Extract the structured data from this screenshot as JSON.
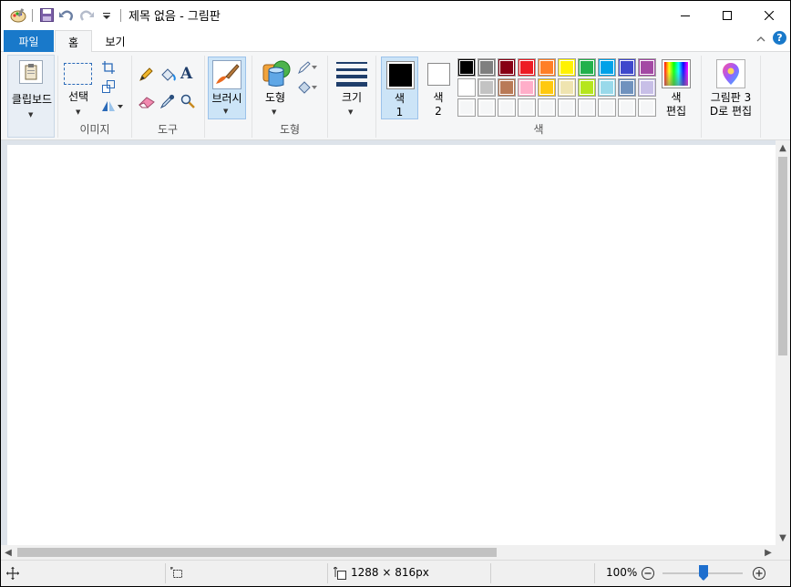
{
  "window": {
    "title": "제목 없음 - 그림판",
    "minimize_glyph": "—",
    "maximize_glyph": "☐",
    "close_glyph": "✕"
  },
  "quick_access": {
    "icons": [
      "paint-app-icon",
      "save-icon",
      "undo-icon",
      "redo-icon",
      "customize-dropdown-icon"
    ]
  },
  "tabs": {
    "file": "파일",
    "home": "홈",
    "view": "보기"
  },
  "ribbon": {
    "clipboard": {
      "label": "클립보드"
    },
    "image": {
      "select_label": "선택",
      "group_label": "이미지"
    },
    "tools": {
      "group_label": "도구"
    },
    "brushes": {
      "label": "브러시"
    },
    "shapes": {
      "label": "도형",
      "group_label": "도형"
    },
    "size": {
      "label": "크기"
    },
    "colors": {
      "color1_label_a": "색",
      "color1_label_b": "1",
      "color2_label_a": "색",
      "color2_label_b": "2",
      "edit_label_a": "색",
      "edit_label_b": "편집",
      "group_label": "색",
      "color1": "#000000",
      "color2": "#ffffff",
      "palette_row1": [
        "#000000",
        "#7f7f7f",
        "#880015",
        "#ed1c24",
        "#ff7f27",
        "#fff200",
        "#22b14c",
        "#00a2e8",
        "#3f48cc",
        "#a349a4"
      ],
      "palette_row2": [
        "#ffffff",
        "#c3c3c3",
        "#b97a57",
        "#ffaec9",
        "#ffc90e",
        "#efe4b0",
        "#b5e61d",
        "#99d9ea",
        "#7092be",
        "#c8bfe7"
      ],
      "palette_row3": [
        "#f5f6f7",
        "#f5f6f7",
        "#f5f6f7",
        "#f5f6f7",
        "#f5f6f7",
        "#f5f6f7",
        "#f5f6f7",
        "#f5f6f7",
        "#f5f6f7",
        "#f5f6f7"
      ]
    },
    "paint3d": {
      "label_a": "그림판 3",
      "label_b": "D로 편집"
    }
  },
  "status": {
    "image_size": "1288 × 816px",
    "zoom": "100%",
    "zoom_level": 0.5
  }
}
